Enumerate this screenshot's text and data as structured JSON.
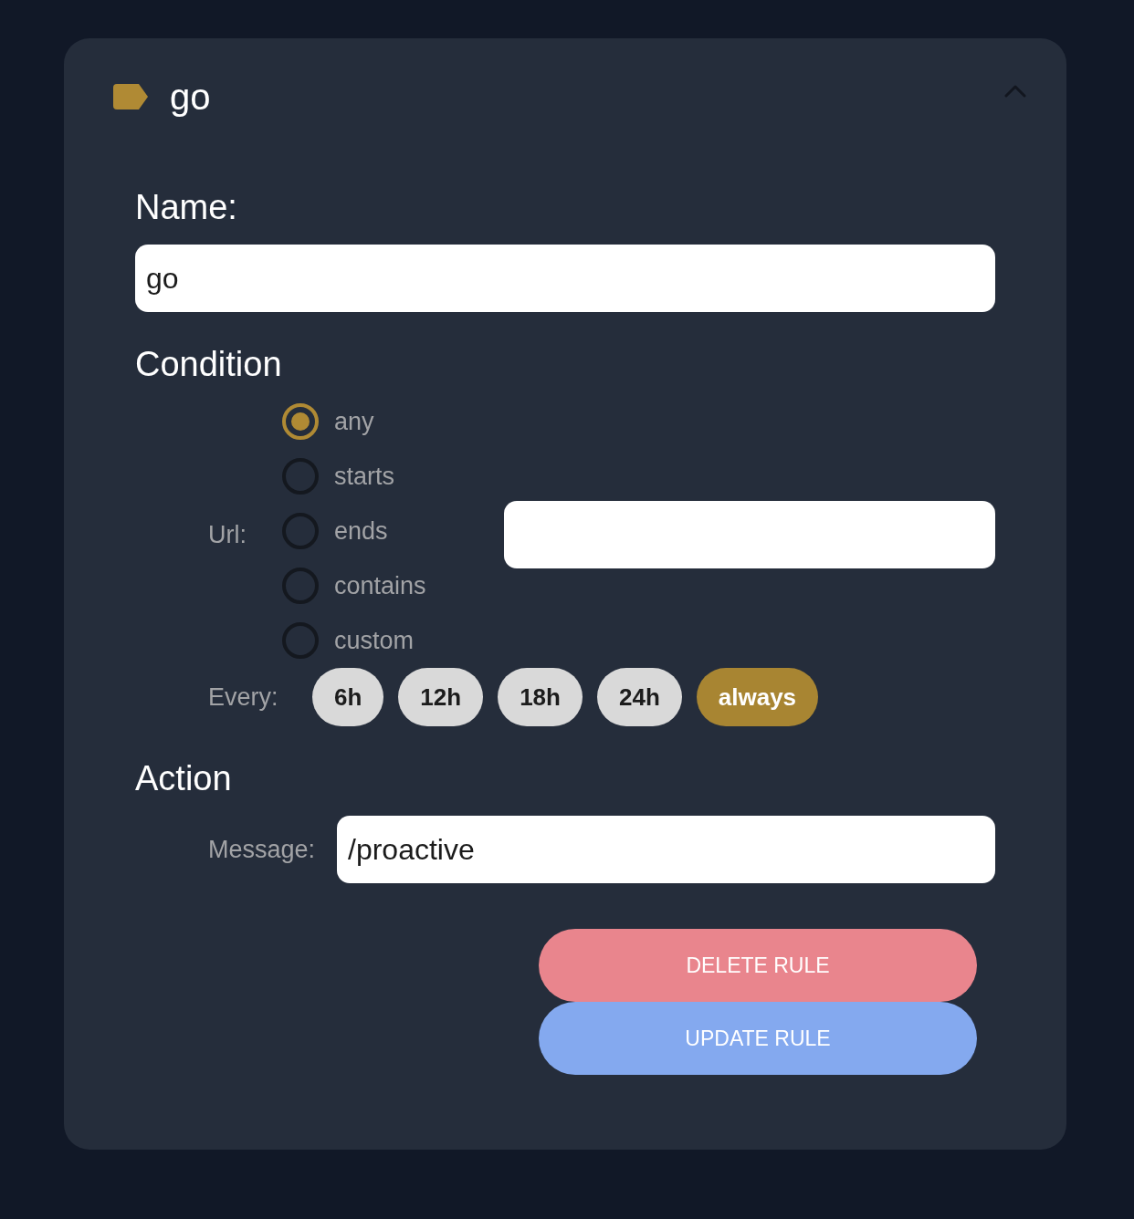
{
  "header": {
    "title": "go",
    "expanded": true
  },
  "name_field": {
    "label": "Name:",
    "value": "go"
  },
  "condition": {
    "heading": "Condition",
    "url": {
      "label": "Url:",
      "options": [
        {
          "label": "any",
          "selected": true
        },
        {
          "label": "starts",
          "selected": false
        },
        {
          "label": "ends",
          "selected": false
        },
        {
          "label": "contains",
          "selected": false
        },
        {
          "label": "custom",
          "selected": false
        }
      ]
    },
    "every": {
      "label": "Every:",
      "options": [
        {
          "label": "6h",
          "selected": false
        },
        {
          "label": "12h",
          "selected": false
        },
        {
          "label": "18h",
          "selected": false
        },
        {
          "label": "24h",
          "selected": false
        },
        {
          "label": "always",
          "selected": true
        }
      ]
    }
  },
  "action": {
    "heading": "Action",
    "message": {
      "label": "Message:",
      "value": "/proactive"
    }
  },
  "buttons": [
    {
      "label": "DELETE RULE",
      "kind": "delete"
    },
    {
      "label": "UPDATE RULE",
      "kind": "update"
    }
  ]
}
